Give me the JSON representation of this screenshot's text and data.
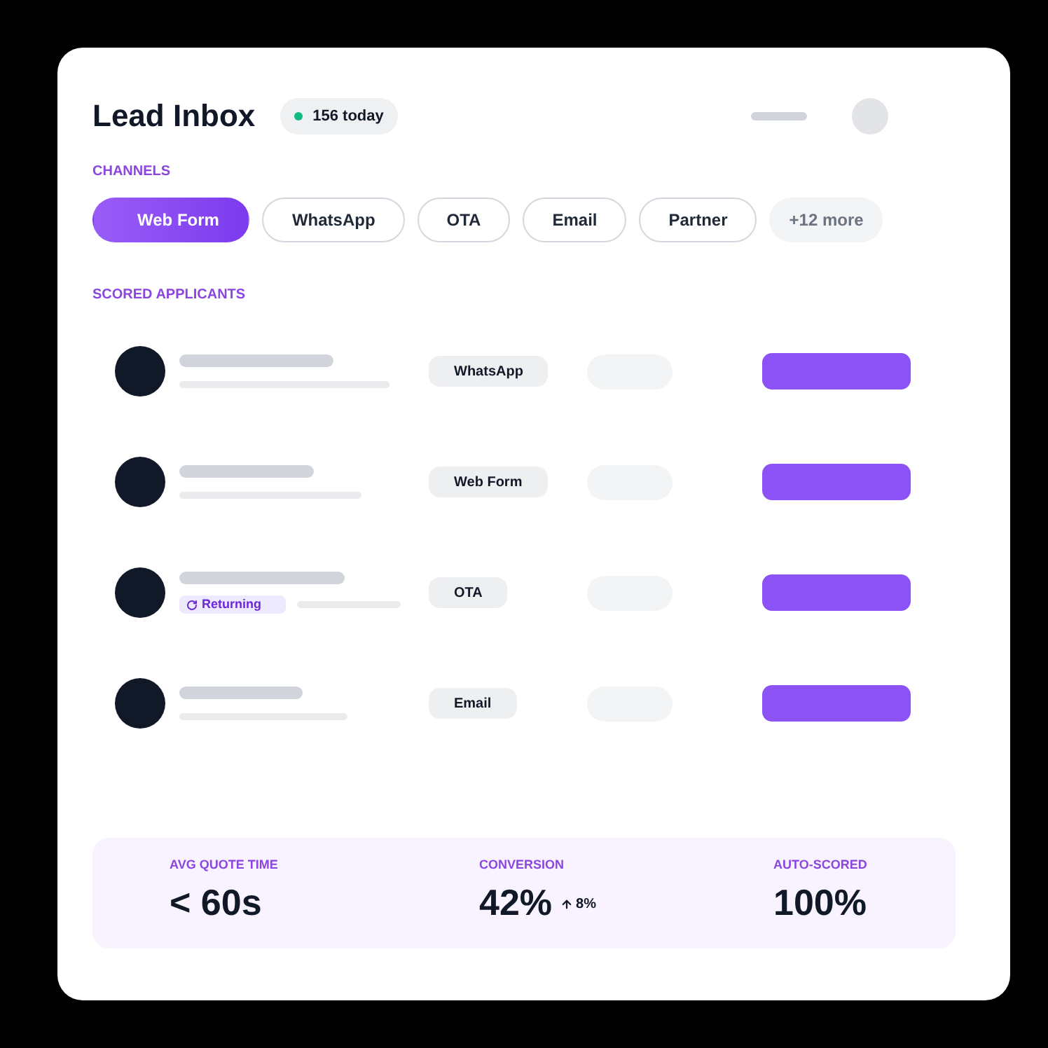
{
  "header": {
    "title": "Lead Inbox",
    "count_badge": "156 today"
  },
  "channels": {
    "label": "CHANNELS",
    "items": [
      {
        "label": "Web Form",
        "selected": true
      },
      {
        "label": "WhatsApp",
        "selected": false
      },
      {
        "label": "OTA",
        "selected": false
      },
      {
        "label": "Email",
        "selected": false
      },
      {
        "label": "Partner",
        "selected": false
      }
    ],
    "more": "+12 more"
  },
  "applicants": {
    "label": "SCORED APPLICANTS",
    "rows": [
      {
        "channel": "WhatsApp"
      },
      {
        "channel": "Web Form"
      },
      {
        "channel": "OTA",
        "badge": "Returning"
      },
      {
        "channel": "Email"
      }
    ]
  },
  "stats": [
    {
      "label": "AVG QUOTE TIME",
      "value": "< 60s"
    },
    {
      "label": "CONVERSION",
      "value": "42%",
      "change": "8%"
    },
    {
      "label": "AUTO-SCORED",
      "value": "100%"
    }
  ]
}
